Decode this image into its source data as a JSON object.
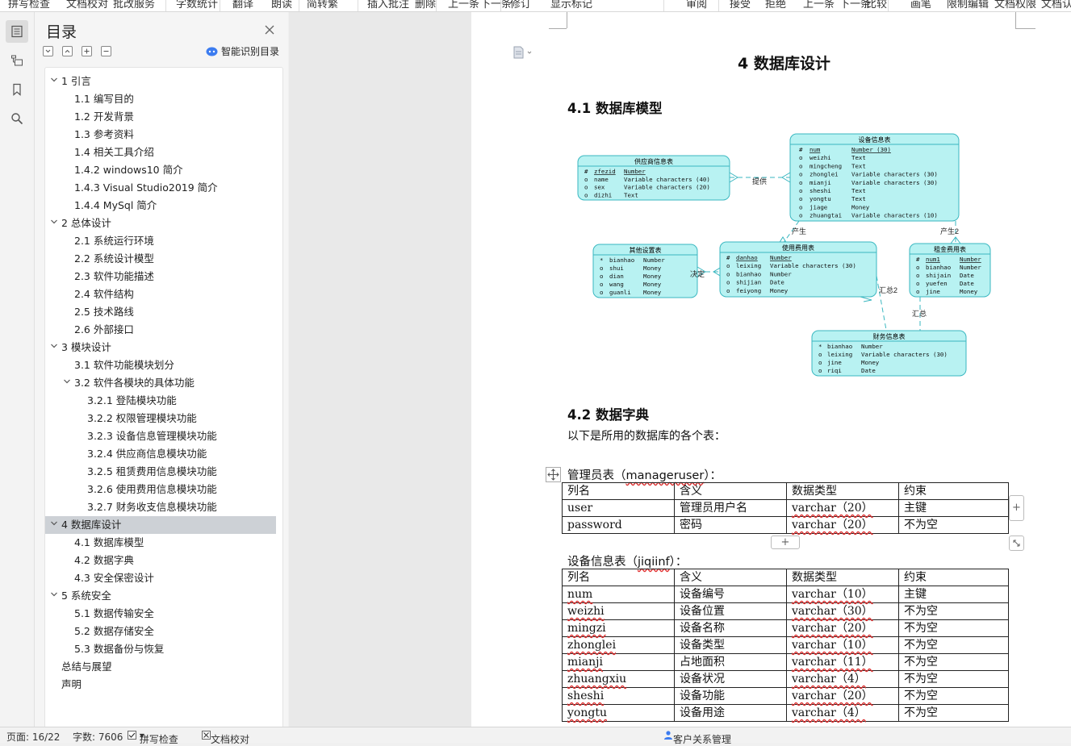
{
  "toolbar": {
    "items": [
      "拼写检查",
      "文档校对",
      "批改服务",
      "字数统计",
      "翻译",
      "朗读",
      "简转繁",
      "插入批注",
      "删除",
      "上一条",
      "下一条",
      "修订",
      "显示标记",
      "审阅",
      "接受",
      "拒绝",
      "上一条",
      "下一条",
      "比较",
      "画笔",
      "限制编辑",
      "文档权限",
      "文档认证"
    ]
  },
  "rail": {
    "icons": [
      "toc-icon",
      "outline-icon",
      "bookmark-icon",
      "search-icon"
    ]
  },
  "toc": {
    "title": "目录",
    "smart_label": "智能识别目录",
    "items": [
      {
        "label": "1  引言",
        "level": 1,
        "expanded": true
      },
      {
        "label": "1.1  编写目的",
        "level": 2
      },
      {
        "label": "1.2  开发背景",
        "level": 2
      },
      {
        "label": "1.3  参考资料",
        "level": 2
      },
      {
        "label": "1.4  相关工具介绍",
        "level": 2
      },
      {
        "label": "1.4.2 windows10 简介",
        "level": 2
      },
      {
        "label": "1.4.3 Visual Studio2019 简介",
        "level": 2
      },
      {
        "label": "1.4.4 MySql 简介",
        "level": 2
      },
      {
        "label": "2  总体设计",
        "level": 1,
        "expanded": true
      },
      {
        "label": "2.1  系统运行环境",
        "level": 2
      },
      {
        "label": "2.2  系统设计模型",
        "level": 2
      },
      {
        "label": "2.3  软件功能描述",
        "level": 2
      },
      {
        "label": "2.4  软件结构",
        "level": 2
      },
      {
        "label": "2.5  技术路线",
        "level": 2
      },
      {
        "label": "2.6  外部接口",
        "level": 2
      },
      {
        "label": "3  模块设计",
        "level": 1,
        "expanded": true
      },
      {
        "label": "3.1  软件功能模块划分",
        "level": 2
      },
      {
        "label": "3.2  软件各模块的具体功能",
        "level": 2,
        "expanded": true
      },
      {
        "label": "3.2.1 登陆模块功能",
        "level": 3
      },
      {
        "label": "3.2.2 权限管理模块功能",
        "level": 3
      },
      {
        "label": "3.2.3 设备信息管理模块功能",
        "level": 3
      },
      {
        "label": "3.2.4 供应商信息模块功能",
        "level": 3
      },
      {
        "label": "3.2.5 租赁费用信息模块功能",
        "level": 3
      },
      {
        "label": "3.2.6 使用费用信息模块功能",
        "level": 3
      },
      {
        "label": "3.2.7 财务收支信息模块功能",
        "level": 3
      },
      {
        "label": "4  数据库设计",
        "level": 1,
        "expanded": true,
        "selected": true
      },
      {
        "label": "4.1  数据库模型",
        "level": 2
      },
      {
        "label": "4.2  数据字典",
        "level": 2
      },
      {
        "label": "4.3  安全保密设计",
        "level": 2
      },
      {
        "label": "5  系统安全",
        "level": 1,
        "expanded": true
      },
      {
        "label": "5.1  数据传输安全",
        "level": 2
      },
      {
        "label": "5.2  数据存储安全",
        "level": 2
      },
      {
        "label": "5.3  数据备份与恢复",
        "level": 2
      },
      {
        "label": "总结与展望",
        "level": 1
      },
      {
        "label": "声明",
        "level": 1
      }
    ]
  },
  "doc": {
    "chapter_title": "4  数据库设计",
    "sec_model": "4.1  数据库模型",
    "sec_dict": "4.2  数据字典",
    "dict_intro": "以下是所用的数据库的各个表：",
    "table1_caption": {
      "pre": "管理员表（",
      "name": "manageruser",
      "post": "）："
    },
    "table2_caption": {
      "pre": "设备信息表（",
      "name": "jiqiinf",
      "post": "）："
    },
    "table_headers": [
      "列名",
      "含义",
      "数据类型",
      "约束"
    ],
    "table1_rows": [
      [
        "user",
        "管理员用户名",
        "varchar（20）",
        "主键"
      ],
      [
        "password",
        "密码",
        "varchar（20）",
        "不为空"
      ]
    ],
    "table2_rows": [
      [
        "num",
        "设备编号",
        "varchar（10）",
        "主键"
      ],
      [
        "weizhi",
        "设备位置",
        "varchar（30）",
        "不为空"
      ],
      [
        "mingzi",
        "设备名称",
        "varchar（20）",
        "不为空"
      ],
      [
        "zhonglei",
        "设备类型",
        "varchar（10）",
        "不为空"
      ],
      [
        "mianji",
        "占地面积",
        "varchar（11）",
        "不为空"
      ],
      [
        "zhuangxiu",
        "设备状况",
        "varchar（4）",
        "不为空"
      ],
      [
        "sheshi",
        "设备功能",
        "varchar（20）",
        "不为空"
      ],
      [
        "yongtu",
        "设备用途",
        "varchar（4）",
        "不为空"
      ]
    ]
  },
  "erd": {
    "entities": [
      {
        "title": "供应商信息表",
        "rows": [
          [
            "#",
            "zfezid",
            "Number"
          ],
          [
            "o",
            "name",
            "Variable characters (40)"
          ],
          [
            "o",
            "sex",
            "Variable characters (20)"
          ],
          [
            "o",
            "dizhi",
            "Text"
          ]
        ]
      },
      {
        "title": "设备信息表",
        "rows": [
          [
            "#",
            "num",
            "Number (30)"
          ],
          [
            "o",
            "weizhi",
            "Text"
          ],
          [
            "o",
            "mingcheng",
            "Text"
          ],
          [
            "o",
            "zhonglei",
            "Variable characters (30)"
          ],
          [
            "o",
            "mianji",
            "Variable characters (30)"
          ],
          [
            "o",
            "sheshi",
            "Text"
          ],
          [
            "o",
            "yongtu",
            "Text"
          ],
          [
            "o",
            "jiage",
            "Money"
          ],
          [
            "o",
            "zhuangtai",
            "Variable characters (10)"
          ]
        ]
      },
      {
        "title": "其他设置表",
        "rows": [
          [
            "*",
            "bianhao",
            "Number"
          ],
          [
            "o",
            "shui",
            "Money"
          ],
          [
            "o",
            "dian",
            "Money"
          ],
          [
            "o",
            "wang",
            "Money"
          ],
          [
            "o",
            "guanli",
            "Money"
          ]
        ]
      },
      {
        "title": "使用费用表",
        "rows": [
          [
            "#",
            "danhao",
            "Number"
          ],
          [
            "o",
            "leixing",
            "Variable characters (30)"
          ],
          [
            "o",
            "bianhao",
            "Number"
          ],
          [
            "o",
            "shijian",
            "Date"
          ],
          [
            "o",
            "feiyong",
            "Money"
          ]
        ]
      },
      {
        "title": "租金费用表",
        "rows": [
          [
            "#",
            "num1",
            "Number"
          ],
          [
            "o",
            "bianhao",
            "Number"
          ],
          [
            "o",
            "shijain",
            "Date"
          ],
          [
            "o",
            "yuefen",
            "Date"
          ],
          [
            "o",
            "jine",
            "Money"
          ]
        ]
      },
      {
        "title": "财务信息表",
        "rows": [
          [
            "*",
            "bianhao",
            "Number"
          ],
          [
            "o",
            "leixing",
            "Variable characters (30)"
          ],
          [
            "o",
            "jine",
            "Money"
          ],
          [
            "o",
            "riqi",
            "Date"
          ]
        ]
      }
    ],
    "relations": [
      "提供",
      "产生",
      "产生2",
      "决定",
      "汇总2",
      "汇总"
    ],
    "color": "#b8f2f2",
    "border": "#3ab7c0"
  },
  "status": {
    "page": "页面: 16/22",
    "words": "字数: 7606",
    "spell": "拼写检查",
    "proof": "文档校对",
    "crm": "客户关系管理"
  }
}
